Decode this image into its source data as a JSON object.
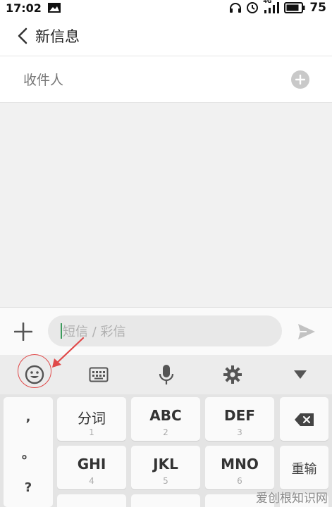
{
  "status_bar": {
    "time": "17:02",
    "signal": "4G",
    "battery": "75"
  },
  "header": {
    "title": "新信息"
  },
  "recipient": {
    "label": "收件人"
  },
  "compose": {
    "placeholder": "短信 / 彩信"
  },
  "keyboard": {
    "punctuation": [
      ",",
      "。",
      "?"
    ],
    "keys": [
      {
        "label": "分词",
        "num": "1"
      },
      {
        "label": "ABC",
        "num": "2"
      },
      {
        "label": "DEF",
        "num": "3"
      },
      {
        "label": "GHI",
        "num": "4"
      },
      {
        "label": "JKL",
        "num": "5"
      },
      {
        "label": "MNO",
        "num": "6"
      }
    ],
    "reenter_label": "重输"
  },
  "watermark": "爱创根知识网",
  "colors": {
    "annotation": "#e04a4a",
    "cursor": "#3c9b5c"
  }
}
